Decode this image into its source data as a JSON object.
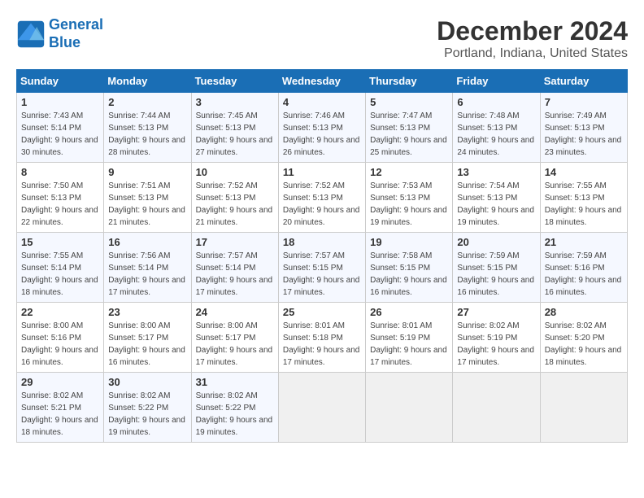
{
  "header": {
    "logo_line1": "General",
    "logo_line2": "Blue",
    "title": "December 2024",
    "subtitle": "Portland, Indiana, United States"
  },
  "calendar": {
    "days_of_week": [
      "Sunday",
      "Monday",
      "Tuesday",
      "Wednesday",
      "Thursday",
      "Friday",
      "Saturday"
    ],
    "weeks": [
      [
        {
          "day": "1",
          "sunrise": "7:43 AM",
          "sunset": "5:14 PM",
          "daylight": "9 hours and 30 minutes."
        },
        {
          "day": "2",
          "sunrise": "7:44 AM",
          "sunset": "5:13 PM",
          "daylight": "9 hours and 28 minutes."
        },
        {
          "day": "3",
          "sunrise": "7:45 AM",
          "sunset": "5:13 PM",
          "daylight": "9 hours and 27 minutes."
        },
        {
          "day": "4",
          "sunrise": "7:46 AM",
          "sunset": "5:13 PM",
          "daylight": "9 hours and 26 minutes."
        },
        {
          "day": "5",
          "sunrise": "7:47 AM",
          "sunset": "5:13 PM",
          "daylight": "9 hours and 25 minutes."
        },
        {
          "day": "6",
          "sunrise": "7:48 AM",
          "sunset": "5:13 PM",
          "daylight": "9 hours and 24 minutes."
        },
        {
          "day": "7",
          "sunrise": "7:49 AM",
          "sunset": "5:13 PM",
          "daylight": "9 hours and 23 minutes."
        }
      ],
      [
        {
          "day": "8",
          "sunrise": "7:50 AM",
          "sunset": "5:13 PM",
          "daylight": "9 hours and 22 minutes."
        },
        {
          "day": "9",
          "sunrise": "7:51 AM",
          "sunset": "5:13 PM",
          "daylight": "9 hours and 21 minutes."
        },
        {
          "day": "10",
          "sunrise": "7:52 AM",
          "sunset": "5:13 PM",
          "daylight": "9 hours and 21 minutes."
        },
        {
          "day": "11",
          "sunrise": "7:52 AM",
          "sunset": "5:13 PM",
          "daylight": "9 hours and 20 minutes."
        },
        {
          "day": "12",
          "sunrise": "7:53 AM",
          "sunset": "5:13 PM",
          "daylight": "9 hours and 19 minutes."
        },
        {
          "day": "13",
          "sunrise": "7:54 AM",
          "sunset": "5:13 PM",
          "daylight": "9 hours and 19 minutes."
        },
        {
          "day": "14",
          "sunrise": "7:55 AM",
          "sunset": "5:13 PM",
          "daylight": "9 hours and 18 minutes."
        }
      ],
      [
        {
          "day": "15",
          "sunrise": "7:55 AM",
          "sunset": "5:14 PM",
          "daylight": "9 hours and 18 minutes."
        },
        {
          "day": "16",
          "sunrise": "7:56 AM",
          "sunset": "5:14 PM",
          "daylight": "9 hours and 17 minutes."
        },
        {
          "day": "17",
          "sunrise": "7:57 AM",
          "sunset": "5:14 PM",
          "daylight": "9 hours and 17 minutes."
        },
        {
          "day": "18",
          "sunrise": "7:57 AM",
          "sunset": "5:15 PM",
          "daylight": "9 hours and 17 minutes."
        },
        {
          "day": "19",
          "sunrise": "7:58 AM",
          "sunset": "5:15 PM",
          "daylight": "9 hours and 16 minutes."
        },
        {
          "day": "20",
          "sunrise": "7:59 AM",
          "sunset": "5:15 PM",
          "daylight": "9 hours and 16 minutes."
        },
        {
          "day": "21",
          "sunrise": "7:59 AM",
          "sunset": "5:16 PM",
          "daylight": "9 hours and 16 minutes."
        }
      ],
      [
        {
          "day": "22",
          "sunrise": "8:00 AM",
          "sunset": "5:16 PM",
          "daylight": "9 hours and 16 minutes."
        },
        {
          "day": "23",
          "sunrise": "8:00 AM",
          "sunset": "5:17 PM",
          "daylight": "9 hours and 16 minutes."
        },
        {
          "day": "24",
          "sunrise": "8:00 AM",
          "sunset": "5:17 PM",
          "daylight": "9 hours and 17 minutes."
        },
        {
          "day": "25",
          "sunrise": "8:01 AM",
          "sunset": "5:18 PM",
          "daylight": "9 hours and 17 minutes."
        },
        {
          "day": "26",
          "sunrise": "8:01 AM",
          "sunset": "5:19 PM",
          "daylight": "9 hours and 17 minutes."
        },
        {
          "day": "27",
          "sunrise": "8:02 AM",
          "sunset": "5:19 PM",
          "daylight": "9 hours and 17 minutes."
        },
        {
          "day": "28",
          "sunrise": "8:02 AM",
          "sunset": "5:20 PM",
          "daylight": "9 hours and 18 minutes."
        }
      ],
      [
        {
          "day": "29",
          "sunrise": "8:02 AM",
          "sunset": "5:21 PM",
          "daylight": "9 hours and 18 minutes."
        },
        {
          "day": "30",
          "sunrise": "8:02 AM",
          "sunset": "5:22 PM",
          "daylight": "9 hours and 19 minutes."
        },
        {
          "day": "31",
          "sunrise": "8:02 AM",
          "sunset": "5:22 PM",
          "daylight": "9 hours and 19 minutes."
        },
        null,
        null,
        null,
        null
      ]
    ]
  }
}
